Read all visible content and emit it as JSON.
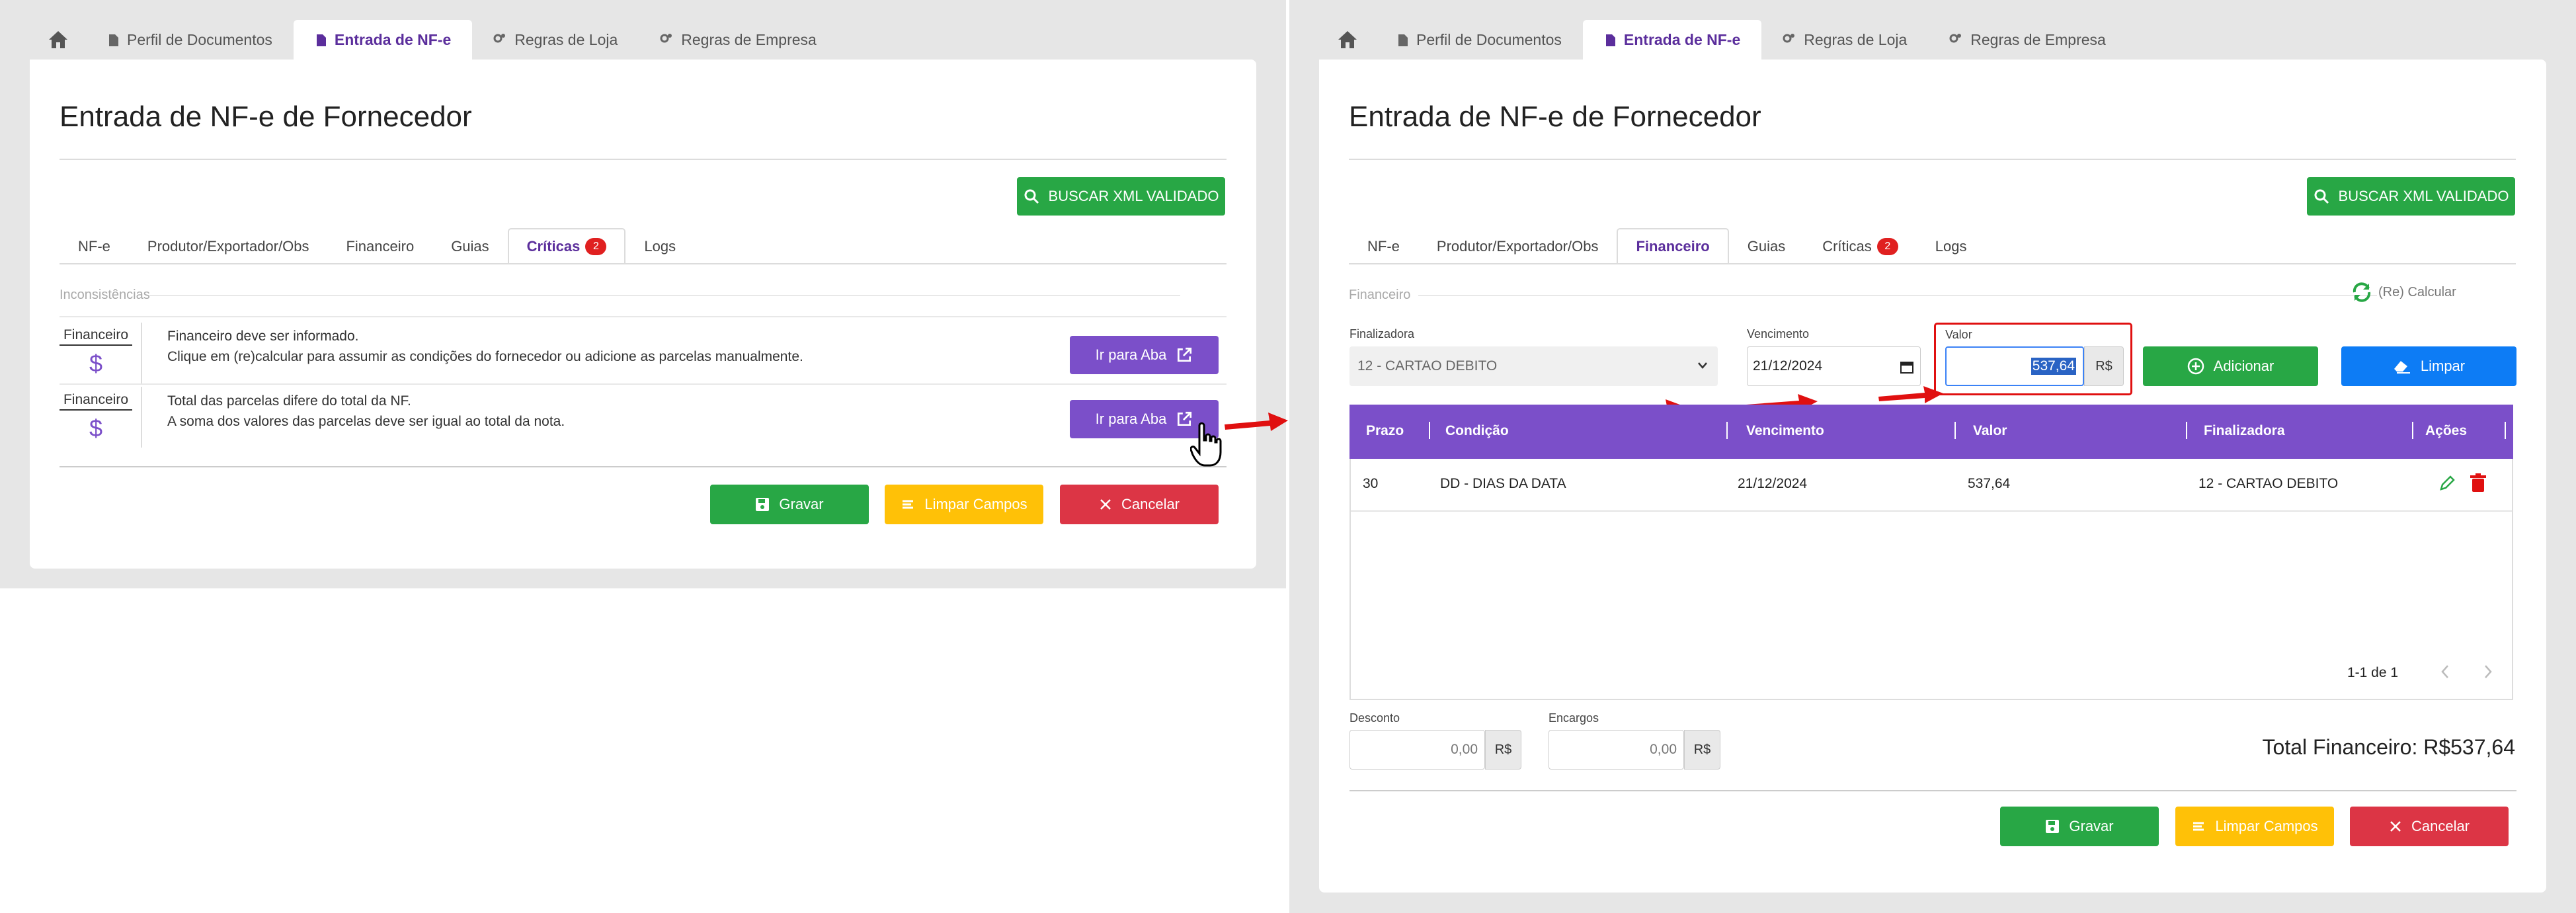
{
  "nav": {
    "tabs": [
      "Perfil de Documentos",
      "Entrada de NF-e",
      "Regras de Loja",
      "Regras de Empresa"
    ]
  },
  "page": {
    "title": "Entrada de NF-e de Fornecedor",
    "search_button": "BUSCAR XML VALIDADO",
    "subtabs": [
      "NF-e",
      "Produtor/Exportador/Obs",
      "Financeiro",
      "Guias",
      "Críticas",
      "Logs"
    ],
    "criticas_count": "2"
  },
  "left": {
    "section": "Inconsistências",
    "issues": [
      {
        "category": "Financeiro",
        "title": "Financeiro deve ser informado.",
        "detail": "Clique em (re)calcular para assumir as condições do fornecedor ou adicione as parcelas manualmente.",
        "button": "Ir para Aba"
      },
      {
        "category": "Financeiro",
        "title": "Total das parcelas difere do total da NF.",
        "detail": "A soma dos valores das parcelas deve ser igual ao total da nota.",
        "button": "Ir para Aba"
      }
    ]
  },
  "right": {
    "section": "Financeiro",
    "recalc": "(Re) Calcular",
    "finalizadora_label": "Finalizadora",
    "finalizadora_value": "12 - CARTAO DEBITO",
    "vencimento_label": "Vencimento",
    "vencimento_value": "21/12/2024",
    "valor_label": "Valor",
    "valor_value": "537,64",
    "currency": "R$",
    "add_button": "Adicionar",
    "clear_button": "Limpar",
    "table": {
      "headers": [
        "Prazo",
        "Condição",
        "Vencimento",
        "Valor",
        "Finalizadora",
        "Ações"
      ],
      "rows": [
        [
          "30",
          "DD - DIAS DA DATA",
          "21/12/2024",
          "537,64",
          "12 - CARTAO DEBITO"
        ]
      ]
    },
    "pagination": "1-1 de 1",
    "desconto_label": "Desconto",
    "desconto_value": "0,00",
    "encargos_label": "Encargos",
    "encargos_value": "0,00",
    "total": "Total Financeiro: R$537,64"
  },
  "footer": {
    "save": "Gravar",
    "clear": "Limpar Campos",
    "cancel": "Cancelar"
  },
  "colors": {
    "accent": "#7b4fc9",
    "success": "#28a745",
    "warning": "#ffc107",
    "danger": "#dc3545",
    "primary": "#0d7cf5"
  }
}
